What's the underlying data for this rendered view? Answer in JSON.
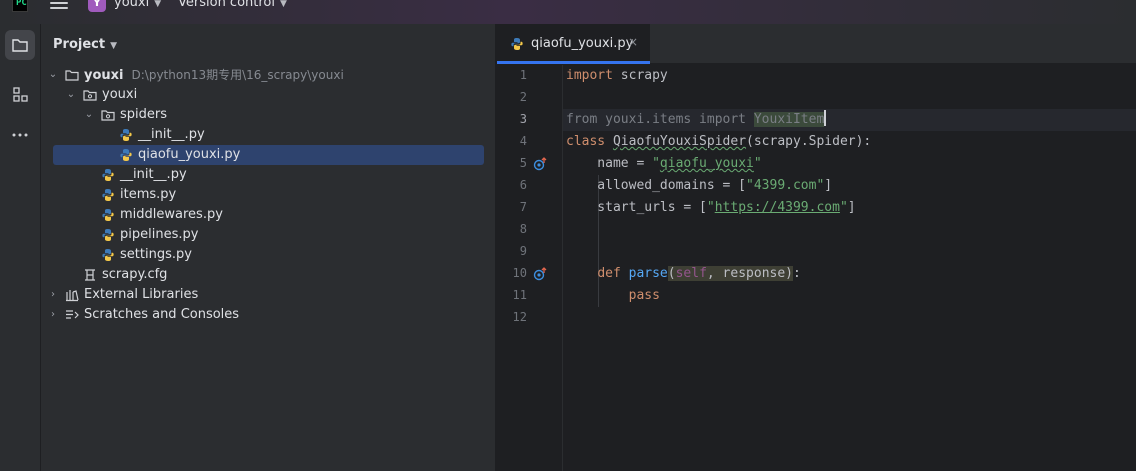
{
  "titlebar": {
    "logo_text": "PC",
    "project_badge": "Y",
    "project_name": "youxi",
    "version_control": "Version control"
  },
  "toolstrip": {
    "items": [
      "project-icon",
      "structure-icon",
      "more-icon"
    ]
  },
  "project_panel": {
    "title": "Project",
    "root_name": "youxi",
    "root_path": "D:\\python13期专用\\16_scrapy\\youxi",
    "tree": [
      {
        "label": "youxi",
        "icon": "package-icon"
      },
      {
        "label": "spiders",
        "icon": "package-icon"
      },
      {
        "label": "__init__.py",
        "icon": "python-file-icon"
      },
      {
        "label": "qiaofu_youxi.py",
        "icon": "python-file-icon"
      },
      {
        "label": "__init__.py",
        "icon": "python-file-icon"
      },
      {
        "label": "items.py",
        "icon": "python-file-icon"
      },
      {
        "label": "middlewares.py",
        "icon": "python-file-icon"
      },
      {
        "label": "pipelines.py",
        "icon": "python-file-icon"
      },
      {
        "label": "settings.py",
        "icon": "python-file-icon"
      },
      {
        "label": "scrapy.cfg",
        "icon": "config-file-icon"
      },
      {
        "label": "External Libraries",
        "icon": "library-icon"
      },
      {
        "label": "Scratches and Consoles",
        "icon": "scratches-icon"
      }
    ]
  },
  "editor": {
    "tab_label": "qiaofu_youxi.py",
    "tab_close": "×",
    "current_line": 3,
    "line_numbers": [
      "1",
      "2",
      "3",
      "4",
      "5",
      "6",
      "7",
      "8",
      "9",
      "10",
      "11",
      "12"
    ],
    "code": {
      "l1_kw": "import",
      "l1_rest": " scrapy",
      "l3_a": "from youxi.items import ",
      "l3_b": "YouxiItem",
      "l4_kw": "class",
      "l4_name": "QiaofuYouxiSpider",
      "l4_rest": "(scrapy.Spider):",
      "l5_a": "    name = ",
      "l5_q1": "\"",
      "l5_s": "qiaofu_youxi",
      "l5_q2": "\"",
      "l6_a": "    allowed_domains = [",
      "l6_s": "\"4399.com\"",
      "l6_b": "]",
      "l7_a": "    start_urls = [",
      "l7_q1": "\"",
      "l7_s": "https://4399.com",
      "l7_q2": "\"",
      "l7_b": "]",
      "l10_indent": "    ",
      "l10_kw": "def",
      "l10_sp": " ",
      "l10_fn": "parse",
      "l10_p1": "(",
      "l10_self": "self",
      "l10_rest": ", response)",
      "l10_colon": ":",
      "l11_indent": "        ",
      "l11_kw": "pass"
    }
  },
  "colors": {
    "accent": "#3574f0",
    "keyword": "#cf8e6d",
    "string": "#6aab73",
    "function": "#56a8f5",
    "self": "#94558d",
    "selection": "#2e436e"
  }
}
